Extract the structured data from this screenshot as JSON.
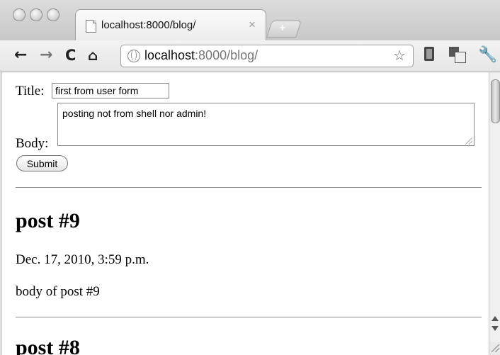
{
  "tab": {
    "title": "localhost:8000/blog/",
    "close_symbol": "×",
    "new_tab_symbol": "+"
  },
  "toolbar": {
    "back_symbol": "←",
    "forward_symbol": "→",
    "reload_symbol": "C",
    "home_symbol": "⌂",
    "url_host": "localhost",
    "url_path": ":8000/blog/",
    "bookmark_star": "☆",
    "wrench_symbol": "🔧"
  },
  "form": {
    "title_label": "Title:",
    "title_value": "first from user form",
    "body_label": "Body:",
    "body_value": "posting not from shell nor admin!",
    "submit_label": "Submit"
  },
  "posts": [
    {
      "title": "post #9",
      "date": "Dec. 17, 2010, 3:59 p.m.",
      "body": "body of post #9"
    },
    {
      "title": "post #8"
    }
  ],
  "icons": {
    "page": "page-icon",
    "globe": "globe-icon",
    "book": "book-icon",
    "translate": "translate-icon",
    "wrench": "wrench-icon"
  }
}
